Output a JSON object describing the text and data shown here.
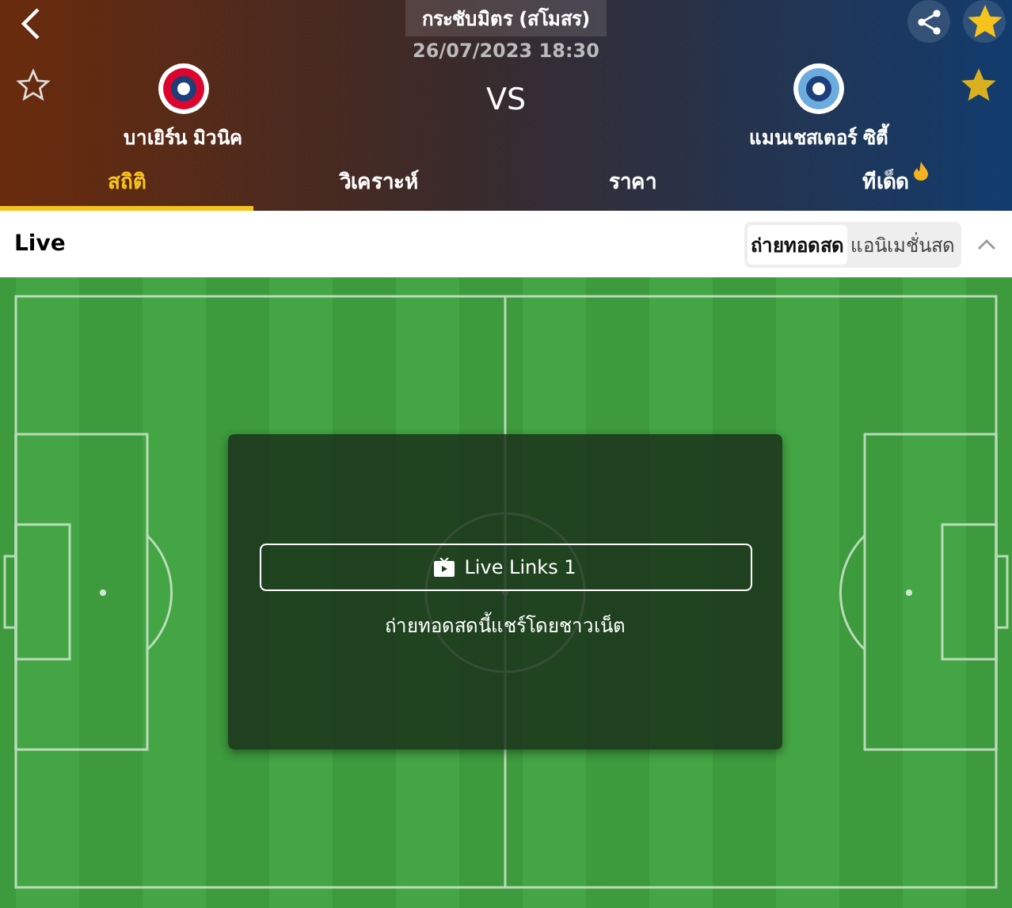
{
  "header": {
    "competition": "กระชับมิตร (สโมสร)",
    "datetime": "26/07/2023 18:30",
    "vs": "VS",
    "match_favorite": true,
    "teams": [
      {
        "name": "บาเยิร์น มิวนิค",
        "favorite": false,
        "color": "#dc052d"
      },
      {
        "name": "แมนเชสเตอร์ ซิตี้",
        "favorite": true,
        "color": "#6cabdd"
      }
    ]
  },
  "tabs": [
    {
      "label": "สถิติ",
      "selected": true,
      "hot": false
    },
    {
      "label": "วิเคราะห์",
      "selected": false,
      "hot": false
    },
    {
      "label": "ราคา",
      "selected": false,
      "hot": false
    },
    {
      "label": "ทีเด็ด",
      "selected": false,
      "hot": true
    }
  ],
  "live": {
    "title": "Live",
    "expanded": true,
    "modes": [
      {
        "label": "ถ่ายทอดสด",
        "selected": true
      },
      {
        "label": "แอนิเมชั่นสด",
        "selected": false
      }
    ],
    "links_button": "Live Links 1",
    "note": "ถ่ายทอดสดนี้แชร์โดยชาวเน็ต"
  }
}
